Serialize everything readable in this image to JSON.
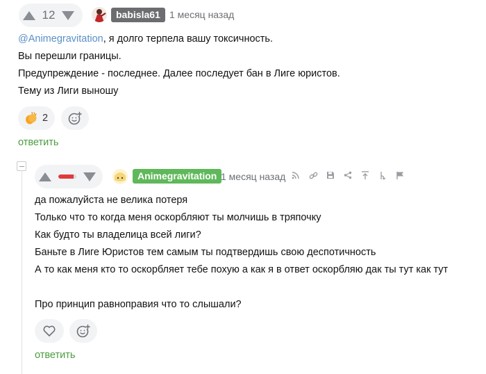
{
  "comment1": {
    "rating": "12",
    "author": "babisla61",
    "author_color": "#6b6d70",
    "time": "1 месяц назад",
    "mention": "@Animegravitation",
    "line1_rest": ", я долго терпела вашу токсичность.",
    "lines": [
      "Вы перешли границы.",
      "Предупреждение - последнее. Далее последует бан в Лиге юристов.",
      "Тему из Лиги выношу"
    ],
    "reaction_icon": "clapping-hands-emoji",
    "reaction_count": "2",
    "reply_label": "ответить"
  },
  "comment2": {
    "rating_negative_fraction": 0.85,
    "author": "Animegravitation",
    "author_color": "#5fb85a",
    "time": "1 месяц назад",
    "lines": [
      "да пожалуйста не велика потеря",
      "Только что то когда меня оскорбляют ты молчишь в тряпочку",
      "Как будто ты владелица всей лиги?",
      "Баньте в Лиге Юристов тем самым ты подтвердишь свою деспотичность",
      "А то как меня кто то оскорбляет тебе похую а как я в ответ оскорбляю дак ты тут как тут",
      "",
      "Про принцип равноправия что то слышали?"
    ],
    "reply_label": "ответить"
  },
  "colors": {
    "accent_green": "#4a9d3f",
    "mention_blue": "#5a8fc7",
    "rating_red": "#e03b3b"
  }
}
